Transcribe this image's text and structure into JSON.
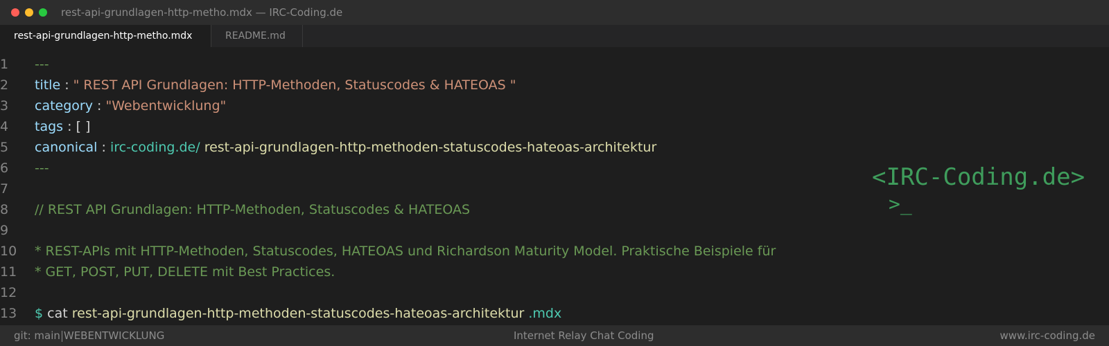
{
  "window": {
    "title": "rest-api-grundlagen-http-metho.mdx — IRC-Coding.de"
  },
  "tabs": [
    {
      "label": "rest-api-grundlagen-http-metho.mdx",
      "active": true
    },
    {
      "label": "README.md",
      "active": false
    }
  ],
  "editor": {
    "line_numbers": [
      "1",
      "2",
      "3",
      "4",
      "5",
      "6",
      "7",
      "8",
      "9",
      "10",
      "11",
      "12",
      "13"
    ],
    "frontmatter_delim": "---",
    "title_key": "title",
    "colon": ":",
    "title_value": "\" REST API Grundlagen: HTTP-Methoden, Statuscodes & HATEOAS \"",
    "category_key": "category",
    "category_value": "\"Webentwicklung\"",
    "tags_key": "tags",
    "tags_value": "[ ]",
    "canonical_key": "canonical",
    "canonical_domain": "irc-coding.de/",
    "canonical_slug": "rest-api-grundlagen-http-methoden-statuscodes-hateoas-architektur",
    "heading_comment": "// REST API Grundlagen: HTTP-Methoden, Statuscodes & HATEOAS",
    "desc_line1": "* REST-APIs mit HTTP-Methoden, Statuscodes, HATEOAS und Richardson Maturity Model. Praktische Beispiele für",
    "desc_line2": "* GET, POST, PUT, DELETE mit Best Practices.",
    "prompt_symbol": "$",
    "command": "cat",
    "file_stem": "rest-api-grundlagen-http-methoden-statuscodes-hateoas-architektur",
    "file_ext": ".mdx"
  },
  "logo": {
    "text": "<IRC-Coding.de>",
    "prompt": ">_"
  },
  "statusbar": {
    "branch": "git: main",
    "category": "WEBENTWICKLUNG",
    "center": "Internet Relay Chat Coding",
    "right": "www.irc-coding.de"
  },
  "colors": {
    "background": "#1e1e1e",
    "comment_green": "#6a9955",
    "key_blue": "#9cdcfe",
    "string_orange": "#ce9178",
    "url_teal": "#4ec9b0",
    "path_yellow": "#dcdcaa",
    "logo_green": "#3f9d5c"
  }
}
